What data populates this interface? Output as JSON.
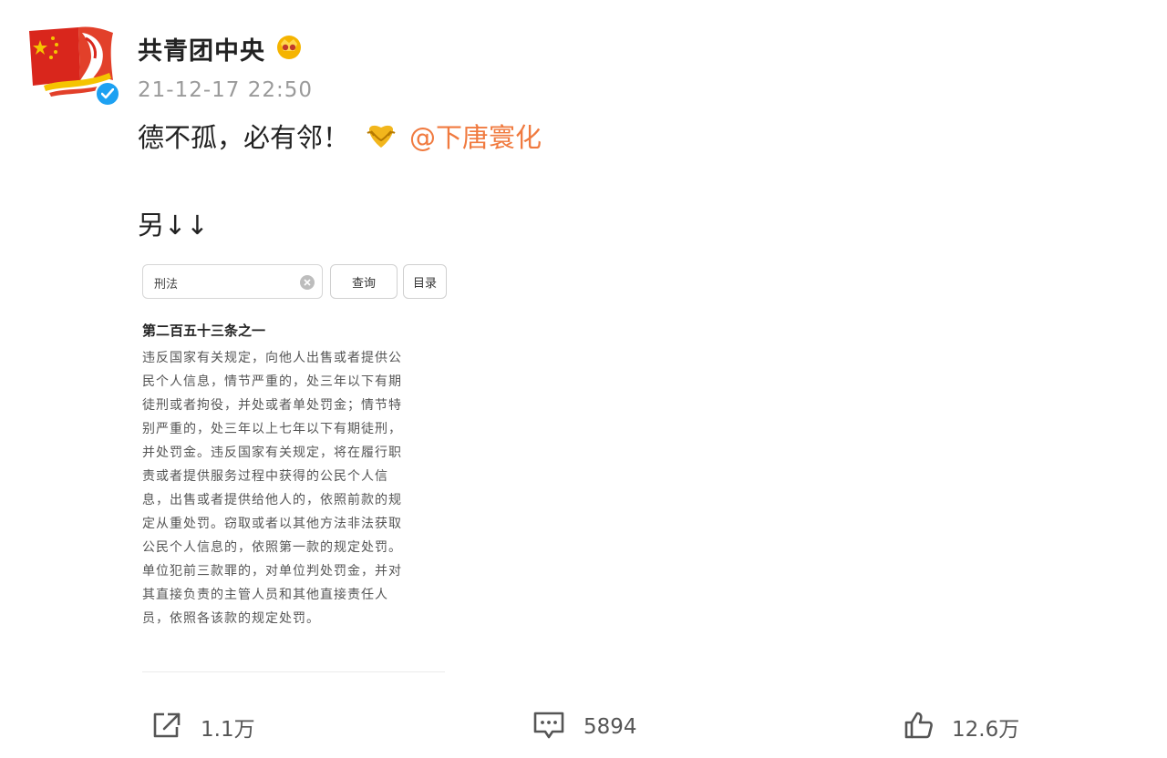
{
  "post": {
    "author": "共青团中央",
    "timestamp": "21-12-17 22:50",
    "text": "德不孤，必有邻！",
    "mention": "@下唐寰化",
    "note": "另↓↓"
  },
  "embed_image": {
    "search_value": "刑法",
    "query_button": "查询",
    "index_button": "目录",
    "article_title": "第二百五十三条之一",
    "article_lines": [
      "违反国家有关规定，向他人出售或者提供公",
      "民个人信息，情节严重的，处三年以下有期",
      "徒刑或者拘役，并处或者单处罚金；情节特",
      "别严重的，处三年以上七年以下有期徒刑，",
      "并处罚金。违反国家有关规定，将在履行职",
      "责或者提供服务过程中获得的公民个人信",
      "息，出售或者提供给他人的，依照前款的规",
      "定从重处罚。窃取或者以其他方法非法获取",
      "公民个人信息的，依照第一款的规定处罚。",
      "单位犯前三款罪的，对单位判处罚金，并对",
      "其直接负责的主管人员和其他直接责任人",
      "员，依照各该款的规定处罚。"
    ]
  },
  "actions": {
    "share_count": "1.1万",
    "comment_count": "5894",
    "like_count": "12.6万"
  },
  "icons": {
    "avatar": "communist-youth-league-logo",
    "verified": "verified-badge-icon",
    "vip": "vip-crown-icon",
    "emoji": "hug-emoji",
    "share": "share-icon",
    "comment": "comment-icon",
    "like": "thumbs-up-icon"
  },
  "colors": {
    "mention": "#f07a3f",
    "verified": "#1da1f2",
    "timestamp": "#9a9a9a",
    "logo_red": "#d9261c",
    "logo_yellow": "#f5c400"
  }
}
